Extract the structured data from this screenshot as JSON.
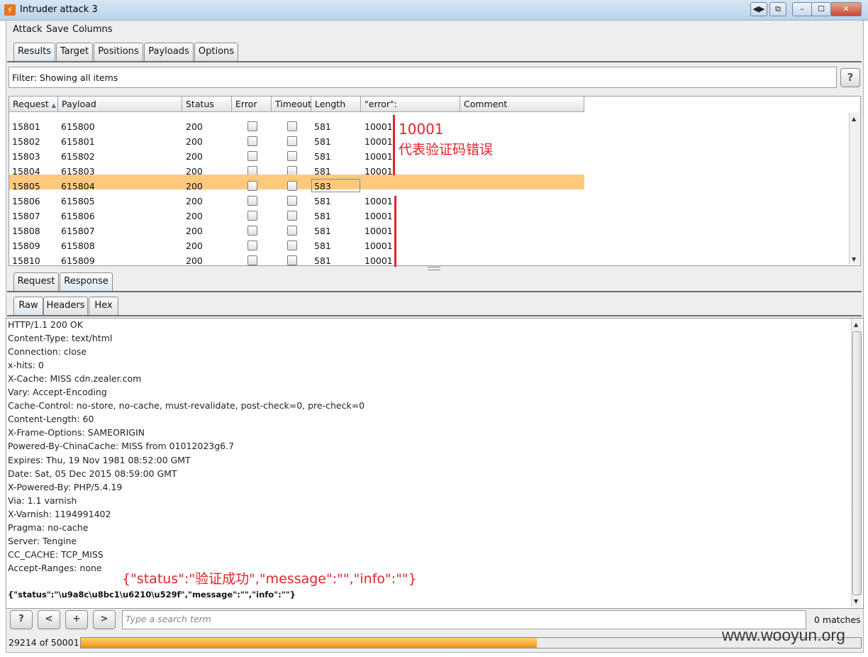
{
  "window": {
    "title": "Intruder attack 3"
  },
  "menu": [
    "Attack",
    "Save",
    "Columns"
  ],
  "main_tabs": [
    {
      "label": "Results",
      "active": true
    },
    {
      "label": "Target",
      "active": false
    },
    {
      "label": "Positions",
      "active": false
    },
    {
      "label": "Payloads",
      "active": false
    },
    {
      "label": "Options",
      "active": false
    }
  ],
  "filter": {
    "text": "Filter: Showing all items",
    "help_label": "?"
  },
  "table": {
    "columns": [
      "Request",
      "Payload",
      "Status",
      "Error",
      "Timeout",
      "Length",
      "\"error\":",
      "Comment"
    ],
    "sort_column": "Request",
    "sort_icon": "sort-ascending-icon",
    "rows": [
      {
        "request": "15801",
        "payload": "615800",
        "status": "200",
        "length": "581",
        "error_code": "10001",
        "selected": false
      },
      {
        "request": "15802",
        "payload": "615801",
        "status": "200",
        "length": "581",
        "error_code": "10001",
        "selected": false
      },
      {
        "request": "15803",
        "payload": "615802",
        "status": "200",
        "length": "581",
        "error_code": "10001",
        "selected": false
      },
      {
        "request": "15804",
        "payload": "615803",
        "status": "200",
        "length": "581",
        "error_code": "10001",
        "selected": false
      },
      {
        "request": "15805",
        "payload": "615804",
        "status": "200",
        "length": "583",
        "error_code": "",
        "selected": true
      },
      {
        "request": "15806",
        "payload": "615805",
        "status": "200",
        "length": "581",
        "error_code": "10001",
        "selected": false
      },
      {
        "request": "15807",
        "payload": "615806",
        "status": "200",
        "length": "581",
        "error_code": "10001",
        "selected": false
      },
      {
        "request": "15808",
        "payload": "615807",
        "status": "200",
        "length": "581",
        "error_code": "10001",
        "selected": false
      },
      {
        "request": "15809",
        "payload": "615808",
        "status": "200",
        "length": "581",
        "error_code": "10001",
        "selected": false
      },
      {
        "request": "15810",
        "payload": "615809",
        "status": "200",
        "length": "581",
        "error_code": "10001",
        "selected": false
      }
    ]
  },
  "annotation_table": {
    "code": "10001",
    "meaning": "代表验证码错误",
    "color": "#e0242a"
  },
  "sub_tabs": [
    {
      "label": "Request",
      "active": false
    },
    {
      "label": "Response",
      "active": true
    }
  ],
  "view_tabs": [
    {
      "label": "Raw",
      "active": true
    },
    {
      "label": "Headers",
      "active": false
    },
    {
      "label": "Hex",
      "active": false
    }
  ],
  "response": {
    "lines": [
      "HTTP/1.1 200 OK",
      "Content-Type: text/html",
      "Connection: close",
      "x-hits: 0",
      "X-Cache: MISS cdn.zealer.com",
      "Vary: Accept-Encoding",
      "Cache-Control: no-store, no-cache, must-revalidate, post-check=0, pre-check=0",
      "Content-Length: 60",
      "X-Frame-Options: SAMEORIGIN",
      "Powered-By-ChinaCache: MISS from 01012023g6.7",
      "Expires: Thu, 19 Nov 1981 08:52:00 GMT",
      "Date: Sat, 05 Dec 2015 08:59:00 GMT",
      "X-Powered-By: PHP/5.4.19",
      "Via: 1.1 varnish",
      "X-Varnish: 1194991402",
      "Pragma: no-cache",
      "Server: Tengine",
      "CC_CACHE: TCP_MISS",
      "Accept-Ranges:  none"
    ],
    "body": "{\"status\":\"\\u9a8c\\u8bc1\\u6210\\u529f\",\"message\":\"\",\"info\":\"\"}",
    "annotation": "{\"status\":\"验证成功\",\"message\":\"\",\"info\":\"\"}"
  },
  "search": {
    "placeholder": "Type a search term",
    "matches": "0 matches",
    "buttons": [
      "?",
      "<",
      "+",
      ">"
    ]
  },
  "progress": {
    "label": "29214 of 50001",
    "fraction": 0.5843,
    "color": "#f29410"
  },
  "watermark": "www.wooyun.org"
}
